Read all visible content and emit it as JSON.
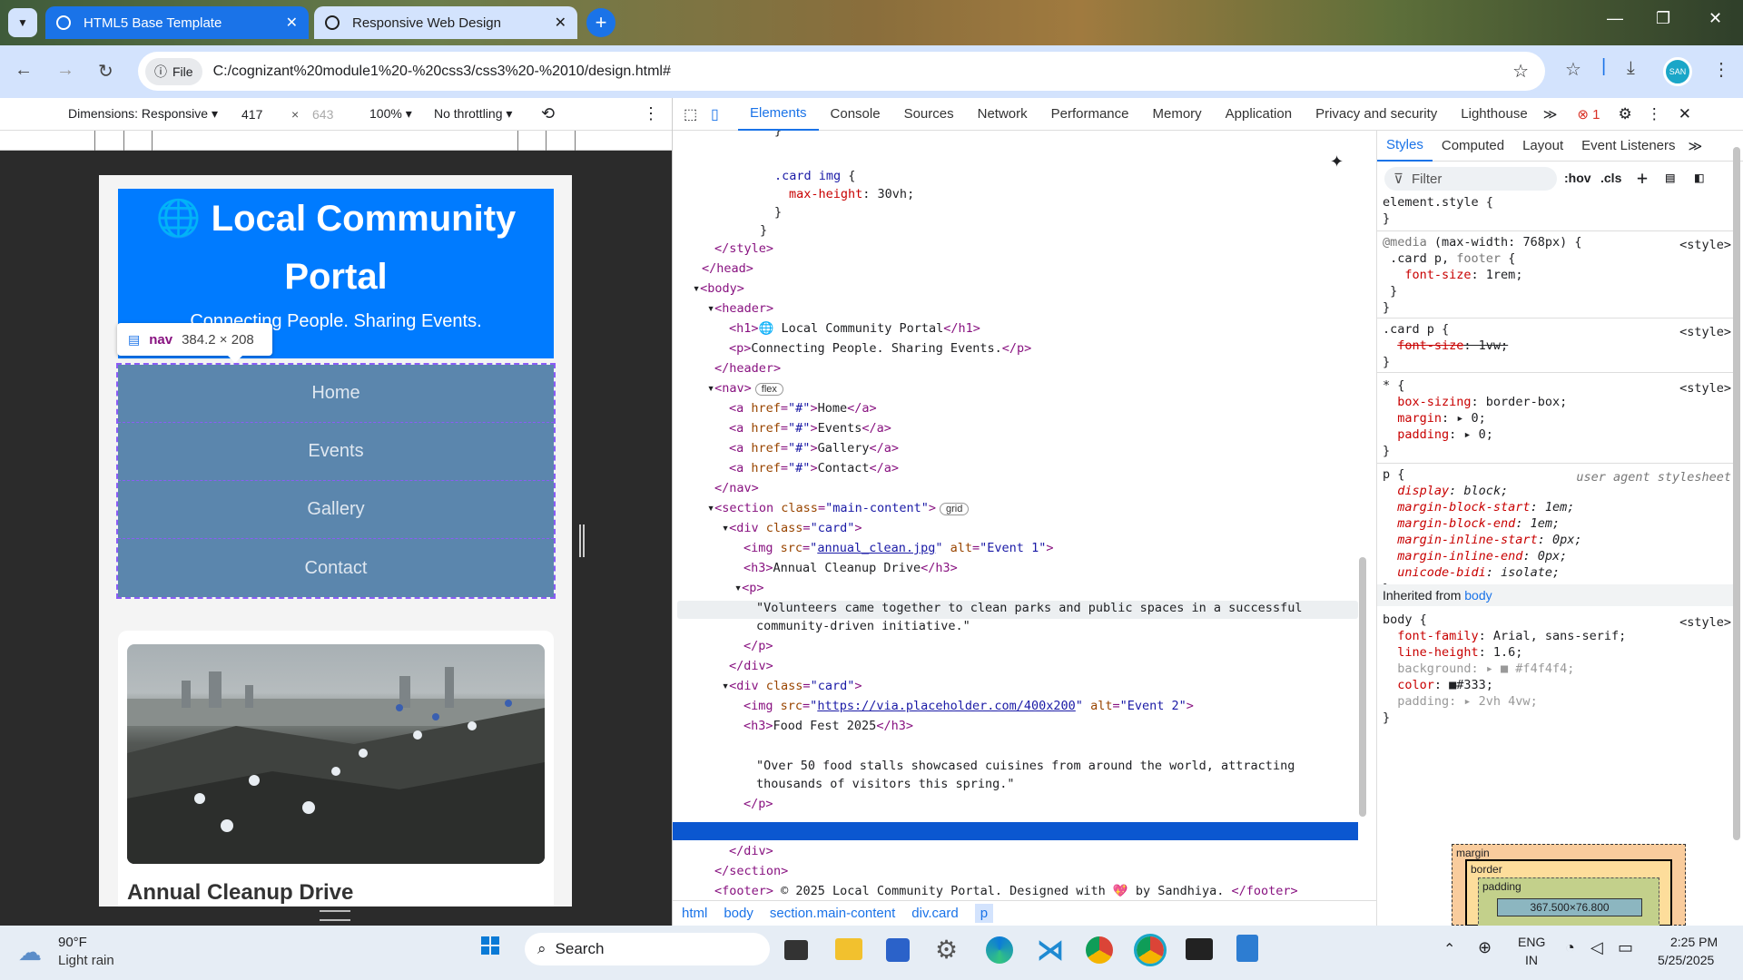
{
  "browser": {
    "tabs": [
      {
        "title": "HTML5 Base Template",
        "active": false
      },
      {
        "title": "Responsive Web Design",
        "active": true
      }
    ],
    "address": {
      "chip": "File",
      "url": "C:/cognizant%20module1%20-%20css3/css3%20-%2010/design.html#"
    },
    "profile_initials": "SAN"
  },
  "device_toolbar": {
    "dimensions_label": "Dimensions: Responsive",
    "width": "417",
    "height": "643",
    "zoom": "100%",
    "throttling": "No throttling"
  },
  "page": {
    "header_icon": "🌐",
    "header_title": "Local Community Portal",
    "header_subtitle": "Connecting People. Sharing Events.",
    "tooltip": {
      "tag": "nav",
      "size": "384.2 × 208"
    },
    "nav_links": [
      "Home",
      "Events",
      "Gallery",
      "Contact"
    ],
    "card_title": "Annual Cleanup Drive"
  },
  "devtools": {
    "tabs": [
      "Elements",
      "Console",
      "Sources",
      "Network",
      "Performance",
      "Memory",
      "Application",
      "Privacy and security",
      "Lighthouse"
    ],
    "active_tab": "Elements",
    "error_count": "1",
    "breadcrumbs": [
      "html",
      "body",
      "section.main-content",
      "div.card",
      "p"
    ],
    "styles_tabs": [
      "Styles",
      "Computed",
      "Layout",
      "Event Listeners"
    ],
    "filter_placeholder": "Filter",
    "filter_hov": ":hov",
    "filter_cls": ".cls",
    "box_model": {
      "margin": "margin",
      "border": "border",
      "padding": "padding",
      "content": "367.500×76.800",
      "dash": "–"
    },
    "inherited_label": "Inherited from",
    "inherited_from": "body"
  },
  "taskbar": {
    "weather_temp": "90°F",
    "weather_desc": "Light rain",
    "search": "Search",
    "lang1": "ENG",
    "lang2": "IN",
    "time": "2:25 PM",
    "date": "5/25/2025"
  },
  "colors": {
    "accent": "#1a73e8",
    "header_blue": "#007bff",
    "nav_bg": "#5b86ad",
    "selection": "#0b57d0"
  }
}
